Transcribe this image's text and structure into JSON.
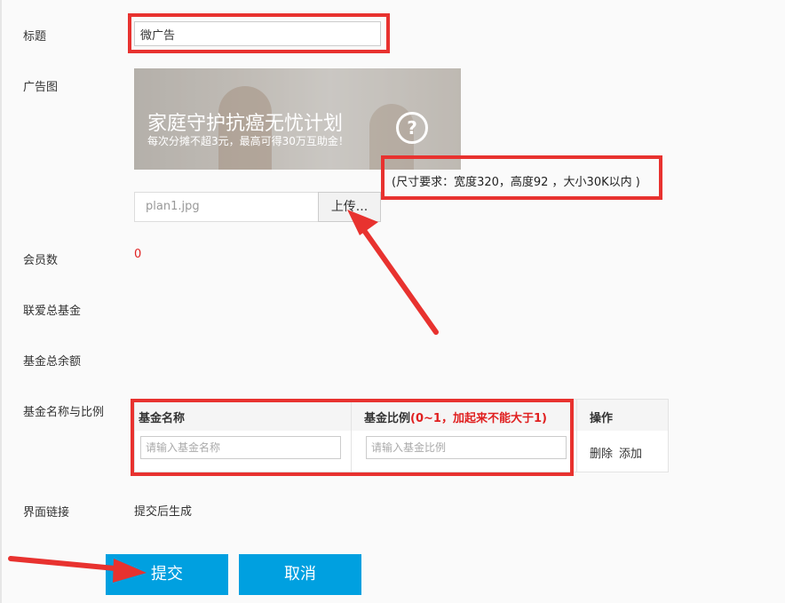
{
  "form": {
    "title_label": "标题",
    "title_value": "微广告",
    "ad_image_label": "广告图",
    "banner": {
      "headline": "家庭守护抗癌无忧计划",
      "subline": "每次分摊不超3元，最高可得30万互助金！",
      "help_icon": "question-circle-icon"
    },
    "size_note": "(尺寸要求：宽度320，高度92 ，大小30K以内 )",
    "file_name": "plan1.jpg",
    "upload_label": "上传...",
    "member_count_label": "会员数",
    "member_count_value": "0",
    "total_fund_label": "联爱总基金",
    "fund_balance_label": "基金总余额",
    "fund_ratio_label": "基金名称与比例",
    "link_label": "界面链接",
    "link_value": "提交后生成"
  },
  "fund_table": {
    "col_name": "基金名称",
    "col_ratio": "基金比例",
    "col_ratio_hint": "(0~1，加起来不能大于1)",
    "col_ops": "操作",
    "name_placeholder": "请输入基金名称",
    "ratio_placeholder": "请输入基金比例",
    "delete_label": "删除",
    "add_label": "添加"
  },
  "actions": {
    "submit_label": "提交",
    "cancel_label": "取消"
  },
  "colors": {
    "accent": "#00a0e0",
    "annotation_red": "#e8322f",
    "member_count": "#e02020"
  }
}
